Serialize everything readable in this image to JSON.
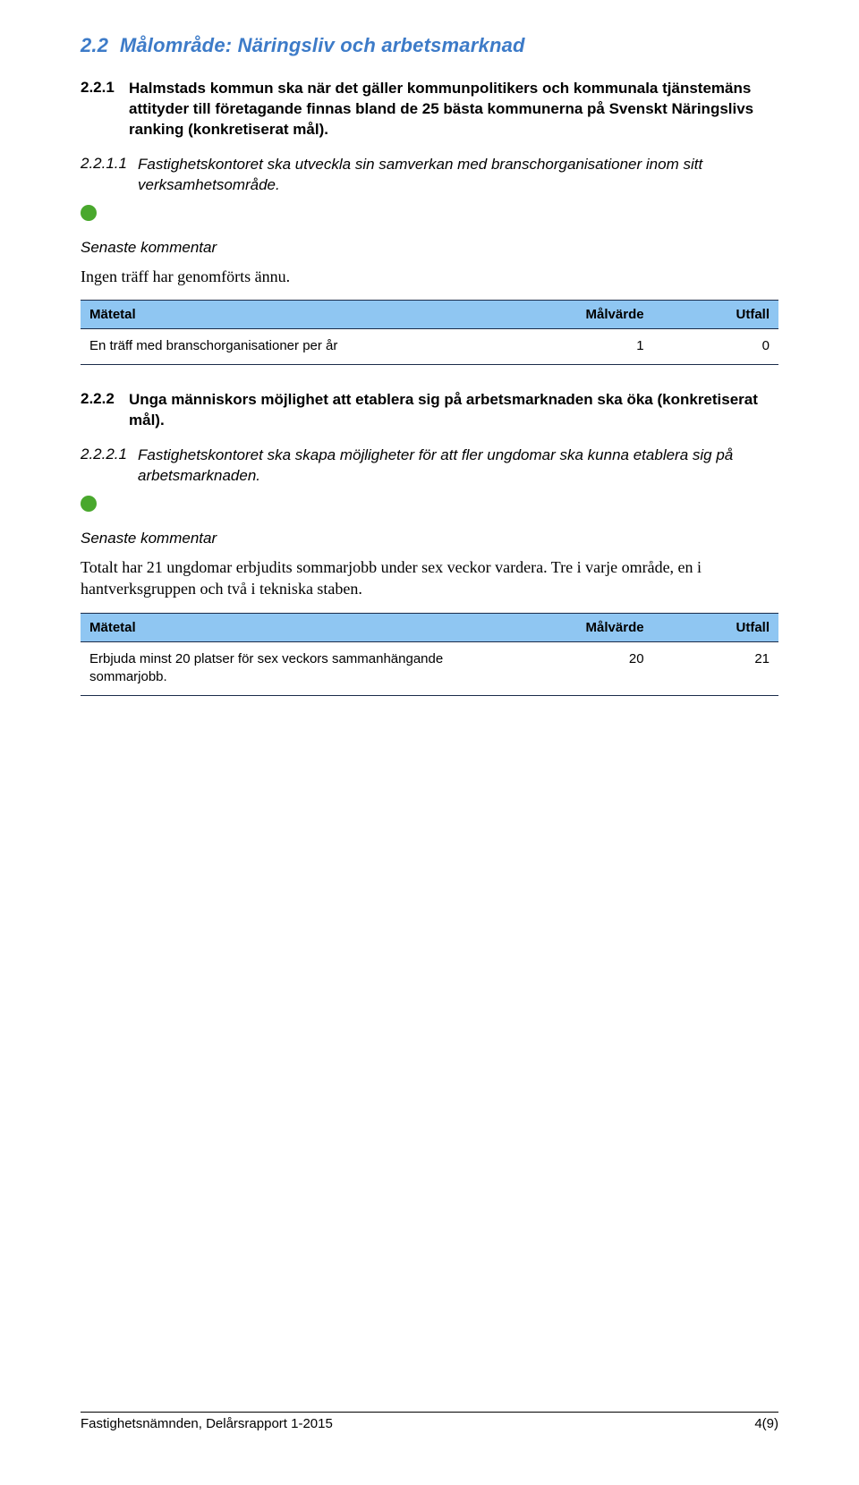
{
  "section_2_2": {
    "number": "2.2",
    "label_prefix": "Målområde:",
    "label_suffix": "Näringsliv och arbetsmarknad",
    "sub_2_2_1": {
      "number": "2.2.1",
      "text": "Halmstads kommun ska när det gäller kommunpolitikers och kommunala tjänstemäns attityder till företagande finnas bland de 25 bästa kommunerna på Svenskt Näringslivs ranking (konkretiserat mål).",
      "item_1": {
        "number": "2.2.1.1",
        "text": "Fastighetskontoret ska utveckla sin samverkan med branschorganisationer inom sitt verksamhetsområde.",
        "comment_label": "Senaste kommentar",
        "comment_body": "Ingen träff har genomförts ännu.",
        "table": {
          "headers": {
            "metric": "Mätetal",
            "target": "Målvärde",
            "outcome": "Utfall"
          },
          "row": {
            "metric": "En träff med branschorganisationer per år",
            "target": "1",
            "outcome": "0"
          }
        }
      }
    },
    "sub_2_2_2": {
      "number": "2.2.2",
      "text": "Unga människors möjlighet att etablera sig på arbetsmarknaden ska öka (konkretiserat mål).",
      "item_1": {
        "number": "2.2.2.1",
        "text": "Fastighetskontoret ska skapa möjligheter för att fler ungdomar ska kunna etablera sig på arbetsmarknaden.",
        "comment_label": "Senaste kommentar",
        "comment_body": "Totalt har 21 ungdomar erbjudits sommarjobb under sex veckor vardera. Tre i varje område, en i hantverksgruppen och två i tekniska staben.",
        "table": {
          "headers": {
            "metric": "Mätetal",
            "target": "Målvärde",
            "outcome": "Utfall"
          },
          "row": {
            "metric": "Erbjuda minst 20 platser för sex veckors sammanhängande sommarjobb.",
            "target": "20",
            "outcome": "21"
          }
        }
      }
    }
  },
  "footer": {
    "left": "Fastighetsnämnden, Delårsrapport 1-2015",
    "right": "4(9)"
  }
}
